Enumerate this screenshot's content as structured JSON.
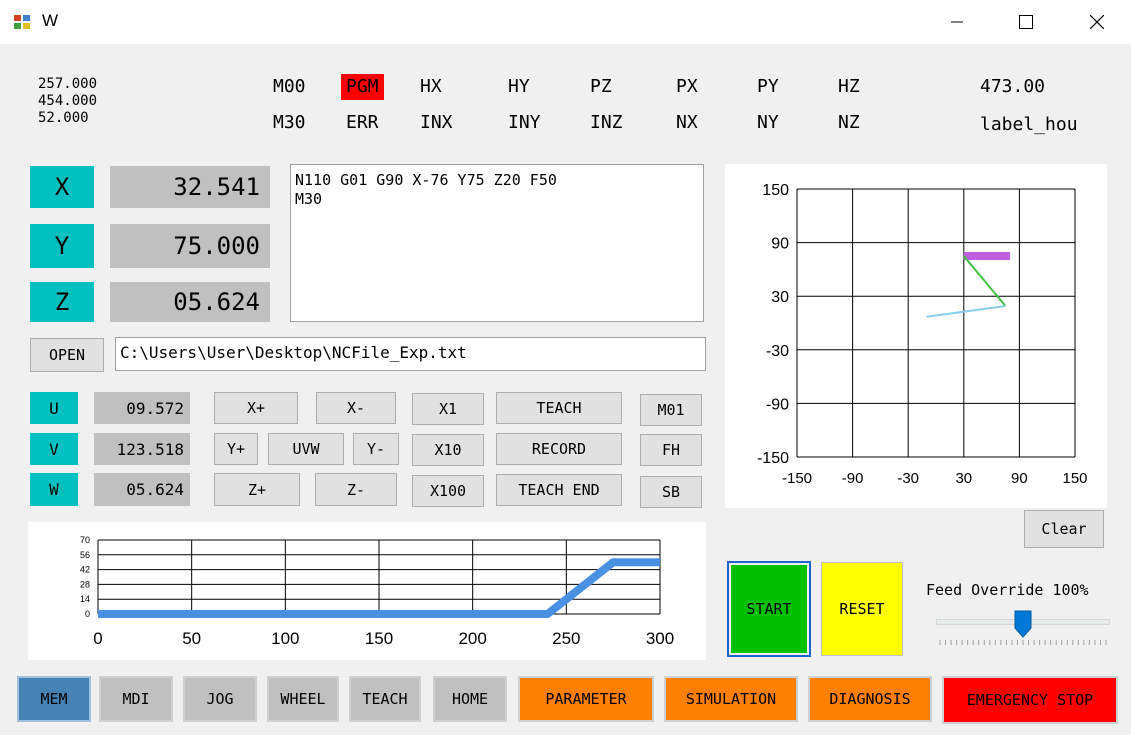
{
  "window": {
    "title": "W"
  },
  "coords_readout": [
    "257.000",
    "454.000",
    "52.000"
  ],
  "status_row1": [
    "M00",
    "PGM",
    "HX",
    "HY",
    "PZ",
    "PX",
    "PY",
    "HZ"
  ],
  "status_row2": [
    "M30",
    "ERR",
    "INX",
    "INY",
    "INZ",
    "NX",
    "NY",
    "NZ"
  ],
  "right_value": "473.00",
  "right_label": "label_hou",
  "axes": [
    {
      "key": "X",
      "value": "32.541"
    },
    {
      "key": "Y",
      "value": "75.000"
    },
    {
      "key": "Z",
      "value": "05.624"
    }
  ],
  "program_text": "N110 G01 G90 X-76 Y75 Z20 F50\nM30",
  "open_label": "OPEN",
  "file_path": "C:\\Users\\User\\Desktop\\NCFile_Exp.txt",
  "aux_axes": [
    {
      "key": "U",
      "value": "09.572"
    },
    {
      "key": "V",
      "value": "123.518"
    },
    {
      "key": "W",
      "value": "05.624"
    }
  ],
  "jog_buttons": {
    "x_plus": "X+",
    "x_minus": "X-",
    "y_plus": "Y+",
    "uvw": "UVW",
    "y_minus": "Y-",
    "z_plus": "Z+",
    "z_minus": "Z-",
    "x1": "X1",
    "x10": "X10",
    "x100": "X100",
    "teach": "TEACH",
    "record": "RECORD",
    "teach_end": "TEACH END",
    "m01": "M01",
    "fh": "FH",
    "sb": "SB"
  },
  "clear_label": "Clear",
  "start_label": "START",
  "reset_label": "RESET",
  "feed_override_label": "Feed Override 100%",
  "feed_override_value": 100,
  "modes": [
    {
      "label": "MEM",
      "active": true
    },
    {
      "label": "MDI"
    },
    {
      "label": "JOG"
    },
    {
      "label": "WHEEL"
    },
    {
      "label": "TEACH"
    },
    {
      "label": "HOME"
    },
    {
      "label": "PARAMETER"
    },
    {
      "label": "SIMULATION"
    },
    {
      "label": "DIAGNOSIS"
    },
    {
      "label": "EMERGENCY STOP"
    }
  ],
  "colors": {
    "axis_key": "#00c0c0",
    "readout": "#c0c0c0",
    "pgm": "#ff0000",
    "start": "#00c000",
    "reset": "#ffff00",
    "orange": "#ff8000",
    "estop": "#ff0000",
    "mem_active": "#4682b4",
    "line": "#4a90e2"
  },
  "chart_data": [
    {
      "type": "line",
      "x_ticks": [
        0,
        50,
        100,
        150,
        200,
        250,
        300
      ],
      "y_ticks": [
        0,
        14,
        28,
        42,
        56,
        70
      ],
      "xlim": [
        0,
        300
      ],
      "ylim": [
        0,
        70
      ],
      "grid": true,
      "x": [
        0,
        240,
        275,
        300
      ],
      "y": [
        0,
        0,
        49,
        49
      ]
    },
    {
      "type": "line",
      "x_ticks": [
        -150,
        -90,
        -30,
        30,
        90,
        150
      ],
      "y_ticks": [
        150,
        90,
        30,
        -30,
        -90,
        -150
      ],
      "xlim": [
        -150,
        150
      ],
      "ylim": [
        -150,
        150
      ],
      "grid": true,
      "series": [
        {
          "color": "#c060e0",
          "x": [
            30,
            80
          ],
          "y": [
            75,
            75
          ]
        },
        {
          "color": "#40c040",
          "x": [
            30,
            75
          ],
          "y": [
            75,
            19
          ]
        },
        {
          "color": "#87ceeb",
          "x": [
            75,
            -10
          ],
          "y": [
            19,
            7
          ]
        }
      ]
    }
  ]
}
